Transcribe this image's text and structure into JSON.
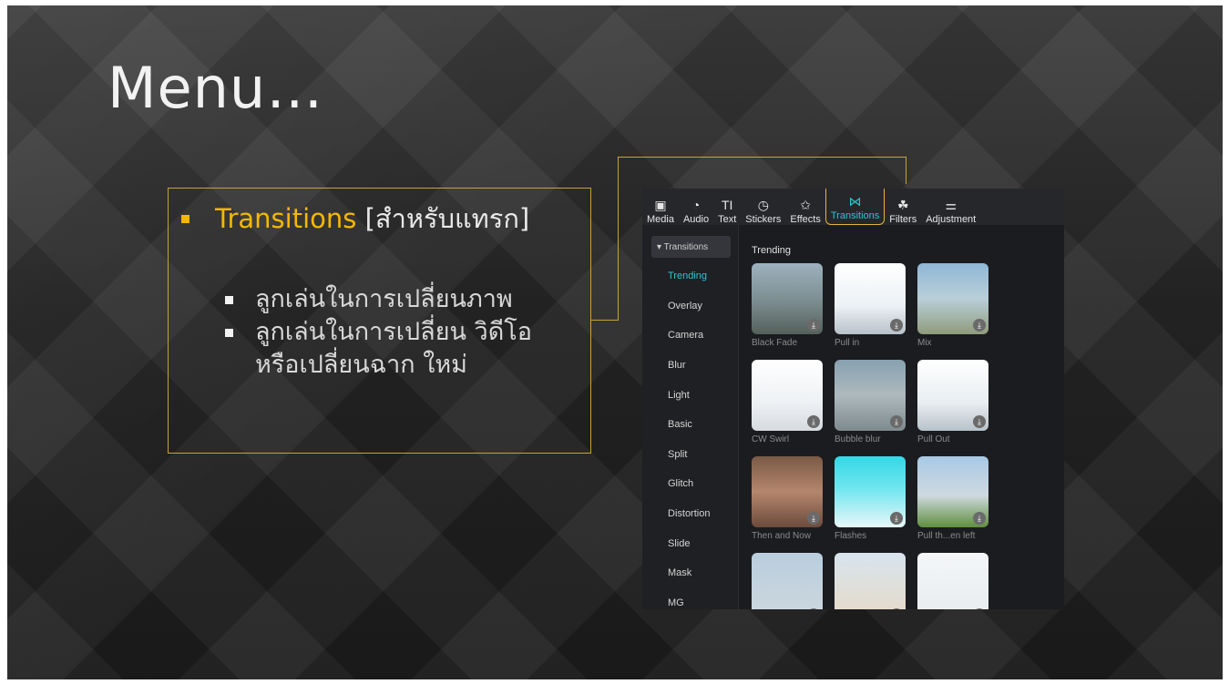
{
  "slide": {
    "title": "Menu…",
    "main_bullet": {
      "highlight": "Transitions",
      "rest": " [สำหรับแทรก]"
    },
    "sub_bullets": [
      "ลูกเล่นในการเปลี่ยนภาพ",
      "ลูกเล่นในการเปลี่ยน วิดีโอ หรือเปลี่ยนฉาก ใหม่"
    ]
  },
  "app": {
    "toolbar": [
      {
        "label": "Media",
        "icon": "media-icon",
        "glyph": "▣"
      },
      {
        "label": "Audio",
        "icon": "audio-icon",
        "glyph": "◔"
      },
      {
        "label": "Text",
        "icon": "text-icon",
        "glyph": "TI"
      },
      {
        "label": "Stickers",
        "icon": "stickers-icon",
        "glyph": "◷"
      },
      {
        "label": "Effects",
        "icon": "effects-icon",
        "glyph": "✩"
      },
      {
        "label": "Transitions",
        "icon": "transitions-icon",
        "glyph": "⋈",
        "active": true
      },
      {
        "label": "Filters",
        "icon": "filters-icon",
        "glyph": "☘"
      },
      {
        "label": "Adjustment",
        "icon": "adjustment-icon",
        "glyph": "⚌"
      }
    ],
    "sidebar": {
      "header": "▾ Transitions",
      "items": [
        "Trending",
        "Overlay",
        "Camera",
        "Blur",
        "Light",
        "Basic",
        "Split",
        "Glitch",
        "Distortion",
        "Slide",
        "Mask",
        "MG"
      ],
      "selected": "Trending"
    },
    "section_title": "Trending",
    "thumbnails": [
      {
        "caption": "Black Fade",
        "style": "t-fade"
      },
      {
        "caption": "Pull in",
        "style": "t-pull"
      },
      {
        "caption": "Mix",
        "style": "t-mix"
      },
      {
        "caption": "CW Swirl",
        "style": "t-swirl"
      },
      {
        "caption": "Bubble blur",
        "style": "t-bubble"
      },
      {
        "caption": "Pull Out",
        "style": "t-pullout"
      },
      {
        "caption": "Then and Now",
        "style": "t-then"
      },
      {
        "caption": "Flashes",
        "style": "t-flash"
      },
      {
        "caption": "Pull th...en left",
        "style": "t-left"
      },
      {
        "caption": "",
        "style": "t-r4a"
      },
      {
        "caption": "",
        "style": "t-r4b"
      },
      {
        "caption": "",
        "style": "t-r4c"
      }
    ],
    "colors": {
      "accent": "#2bc5d6",
      "highlight_border": "#e3b33c",
      "slide_gold": "#f5b800"
    }
  }
}
